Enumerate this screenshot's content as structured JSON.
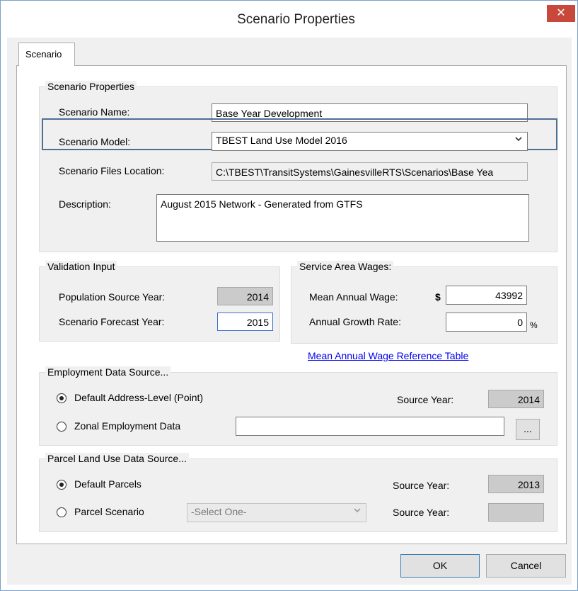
{
  "window": {
    "title": "Scenario Properties",
    "close_glyph": "✕"
  },
  "tabs": [
    {
      "label": "Scenario"
    }
  ],
  "scenario_props": {
    "group_title": "Scenario Properties",
    "name_label": "Scenario Name:",
    "name_value": "Base Year Development",
    "model_label": "Scenario Model:",
    "model_value": "TBEST Land Use Model 2016",
    "files_label": "Scenario Files Location:",
    "files_value": "C:\\TBEST\\TransitSystems\\GainesvilleRTS\\Scenarios\\Base Yea",
    "desc_label": "Description:",
    "desc_value": "August 2015 Network - Generated from GTFS"
  },
  "validation": {
    "group_title": "Validation Input",
    "pop_label": "Population Source Year:",
    "pop_value": "2014",
    "forecast_label": "Scenario Forecast Year:",
    "forecast_value": "2015"
  },
  "wages": {
    "group_title": "Service Area Wages:",
    "mean_label": "Mean Annual Wage:",
    "currency": "$",
    "mean_value": "43992",
    "growth_label": "Annual Growth Rate:",
    "growth_value": "0",
    "percent": "%",
    "link": "Mean Annual Wage Reference Table"
  },
  "employment": {
    "group_title": "Employment Data Source...",
    "opt_default": "Default Address-Level (Point)",
    "opt_zonal": "Zonal Employment Data",
    "source_year_label": "Source Year:",
    "source_year_value": "2014",
    "zonal_path": "",
    "browse_label": "..."
  },
  "parcel": {
    "group_title": "Parcel Land Use Data Source...",
    "opt_default": "Default Parcels",
    "opt_scenario": "Parcel Scenario",
    "select_value": "-Select One-",
    "source_year_label": "Source Year:",
    "source_year_value": "2013",
    "source_year_label2": "Source Year:",
    "source_year_value2": ""
  },
  "buttons": {
    "ok": "OK",
    "cancel": "Cancel"
  },
  "icons": {
    "dropdown": "chevron-down-icon",
    "close": "close-icon"
  }
}
